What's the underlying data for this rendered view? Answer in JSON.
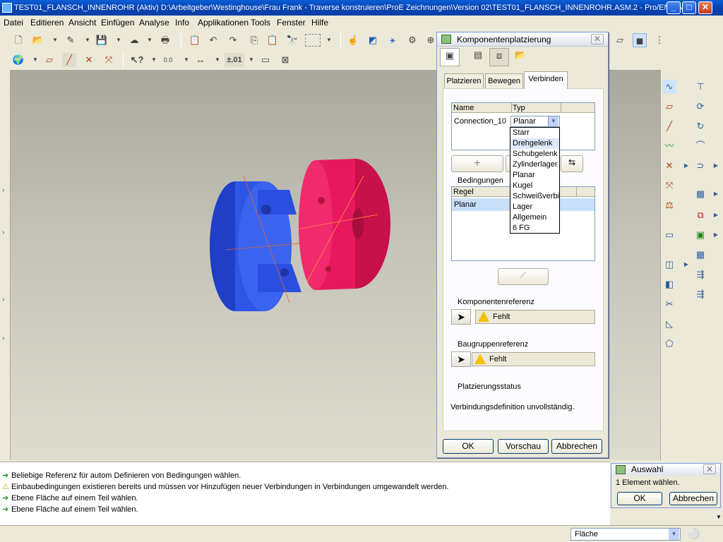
{
  "window": {
    "title": "TEST01_FLANSCH_INNENROHR (Aktiv) D:\\Arbeitgeber\\Westinghouse\\Frau Frank - Traverse konstruieren\\ProE Zeichnungen\\Version 02\\TEST01_FLANSCH_INNENROHR.ASM.2 - Pro/ENGIN...",
    "minimize": "_",
    "maximize": "□",
    "close": "✕"
  },
  "menu": [
    "Datei",
    "Editieren",
    "Ansicht",
    "Einfügen",
    "Analyse",
    "Info",
    "Applikationen",
    "Tools",
    "Fenster",
    "Hilfe"
  ],
  "toolbar": {
    "tolerance": "±.01",
    "precision": "0.0"
  },
  "dialog": {
    "title": "Komponentenplatzierung",
    "tabs": [
      "Platzieren",
      "Bewegen",
      "Verbinden"
    ],
    "active_tab": "Verbinden",
    "table_headers": {
      "name": "Name",
      "type": "Typ"
    },
    "connection_name": "Connection_10",
    "connection_type": "Planar",
    "add_symbol": "+",
    "conditions_label": "Bedingungen",
    "rule_header": "Regel",
    "rule_value": "Planar",
    "component_ref_label": "Komponentenreferenz",
    "component_ref_value": "Fehlt",
    "assembly_ref_label": "Baugruppenreferenz",
    "assembly_ref_value": "Fehlt",
    "status_label": "Platzierungsstatus",
    "status_text": "Verbindungsdefinition unvollständig.",
    "ok": "OK",
    "preview": "Vorschau",
    "cancel": "Abbrechen"
  },
  "dropdown_options": [
    "Starr",
    "Drehgelenk",
    "Schubgelenk",
    "Zylinderlager",
    "Planar",
    "Kugel",
    "Schweißverbi",
    "Lager",
    "Allgemein",
    "6 FG"
  ],
  "dropdown_highlighted": "Drehgelenk",
  "selection_dialog": {
    "title": "Auswahl",
    "message": "1 Element wählen.",
    "ok": "OK",
    "cancel": "Abbrechen"
  },
  "messages": [
    {
      "icon": "arrow-icon",
      "text": "Beliebige Referenz für autom Definieren von Bedingungen wählen."
    },
    {
      "icon": "warning-icon",
      "text": "Einbaubedingungen existieren bereits und müssen vor Hinzufügen neuer Verbindungen in Verbindungen umgewandelt werden."
    },
    {
      "icon": "arrow-icon",
      "text": "Ebene Fläche auf einem Teil wählen."
    },
    {
      "icon": "arrow-icon",
      "text": "Ebene Fläche auf einem Teil wählen."
    }
  ],
  "status": {
    "filter": "Fläche"
  },
  "colors": {
    "part_blue": "#2d55e6",
    "part_red": "#e8185e",
    "title_blue": "#0a5fd8"
  }
}
